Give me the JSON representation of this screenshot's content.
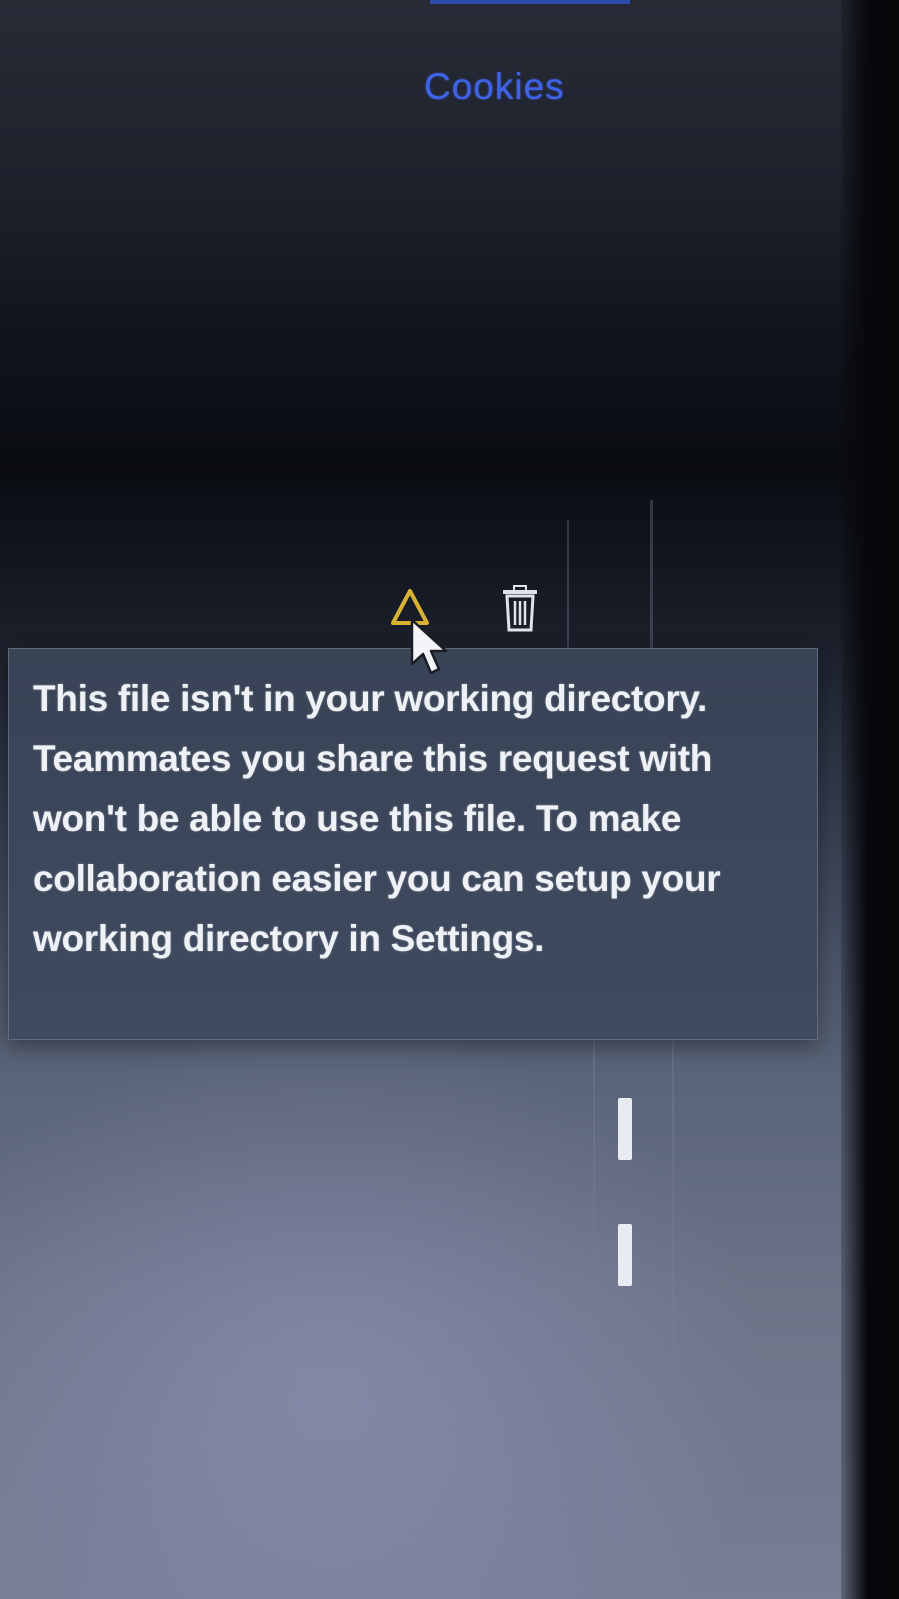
{
  "tabs": {
    "cookies_label": "Cookies"
  },
  "file_row": {
    "warning_icon": "warning-triangle-icon",
    "delete_icon": "trash-icon"
  },
  "tooltip": {
    "message": "This file isn't in your working directory. Teammates you share this request with won't be able to use this file. To make collaboration easier you can setup your working directory in Settings."
  },
  "colors": {
    "tab_link": "#3f63e8",
    "warning": "#d8b233",
    "tooltip_bg": "#3e485c",
    "tooltip_text": "#eef1f6"
  }
}
